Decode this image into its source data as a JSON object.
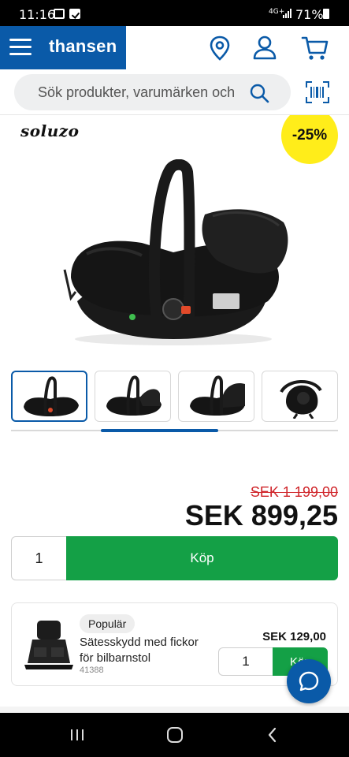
{
  "status_bar": {
    "time": "11:16",
    "network": "4G+",
    "battery": "71%"
  },
  "header": {
    "logo": "thansen",
    "brand_color": "#0a5aa8",
    "icons": [
      "menu-icon",
      "location-pin-icon",
      "user-icon",
      "cart-icon"
    ]
  },
  "search": {
    "placeholder": "Sök produkter, varumärken och"
  },
  "product": {
    "brand_logo": "soluzo",
    "discount": "-25%",
    "old_price": "SEK 1 199,00",
    "new_price": "SEK 899,25",
    "quantity": "1",
    "buy_label": "Köp",
    "gallery_position": 0.27
  },
  "accessory": {
    "badge": "Populär",
    "name": "Sätesskydd med fickor för bilbarnstol",
    "sku": "41388",
    "price": "SEK 129,00",
    "quantity": "1",
    "buy_label": "Köp"
  },
  "colors": {
    "accent_blue": "#0a5aa8",
    "buy_green": "#14a046",
    "badge_yellow": "#ffed1a",
    "old_price_red": "#d0262b"
  }
}
